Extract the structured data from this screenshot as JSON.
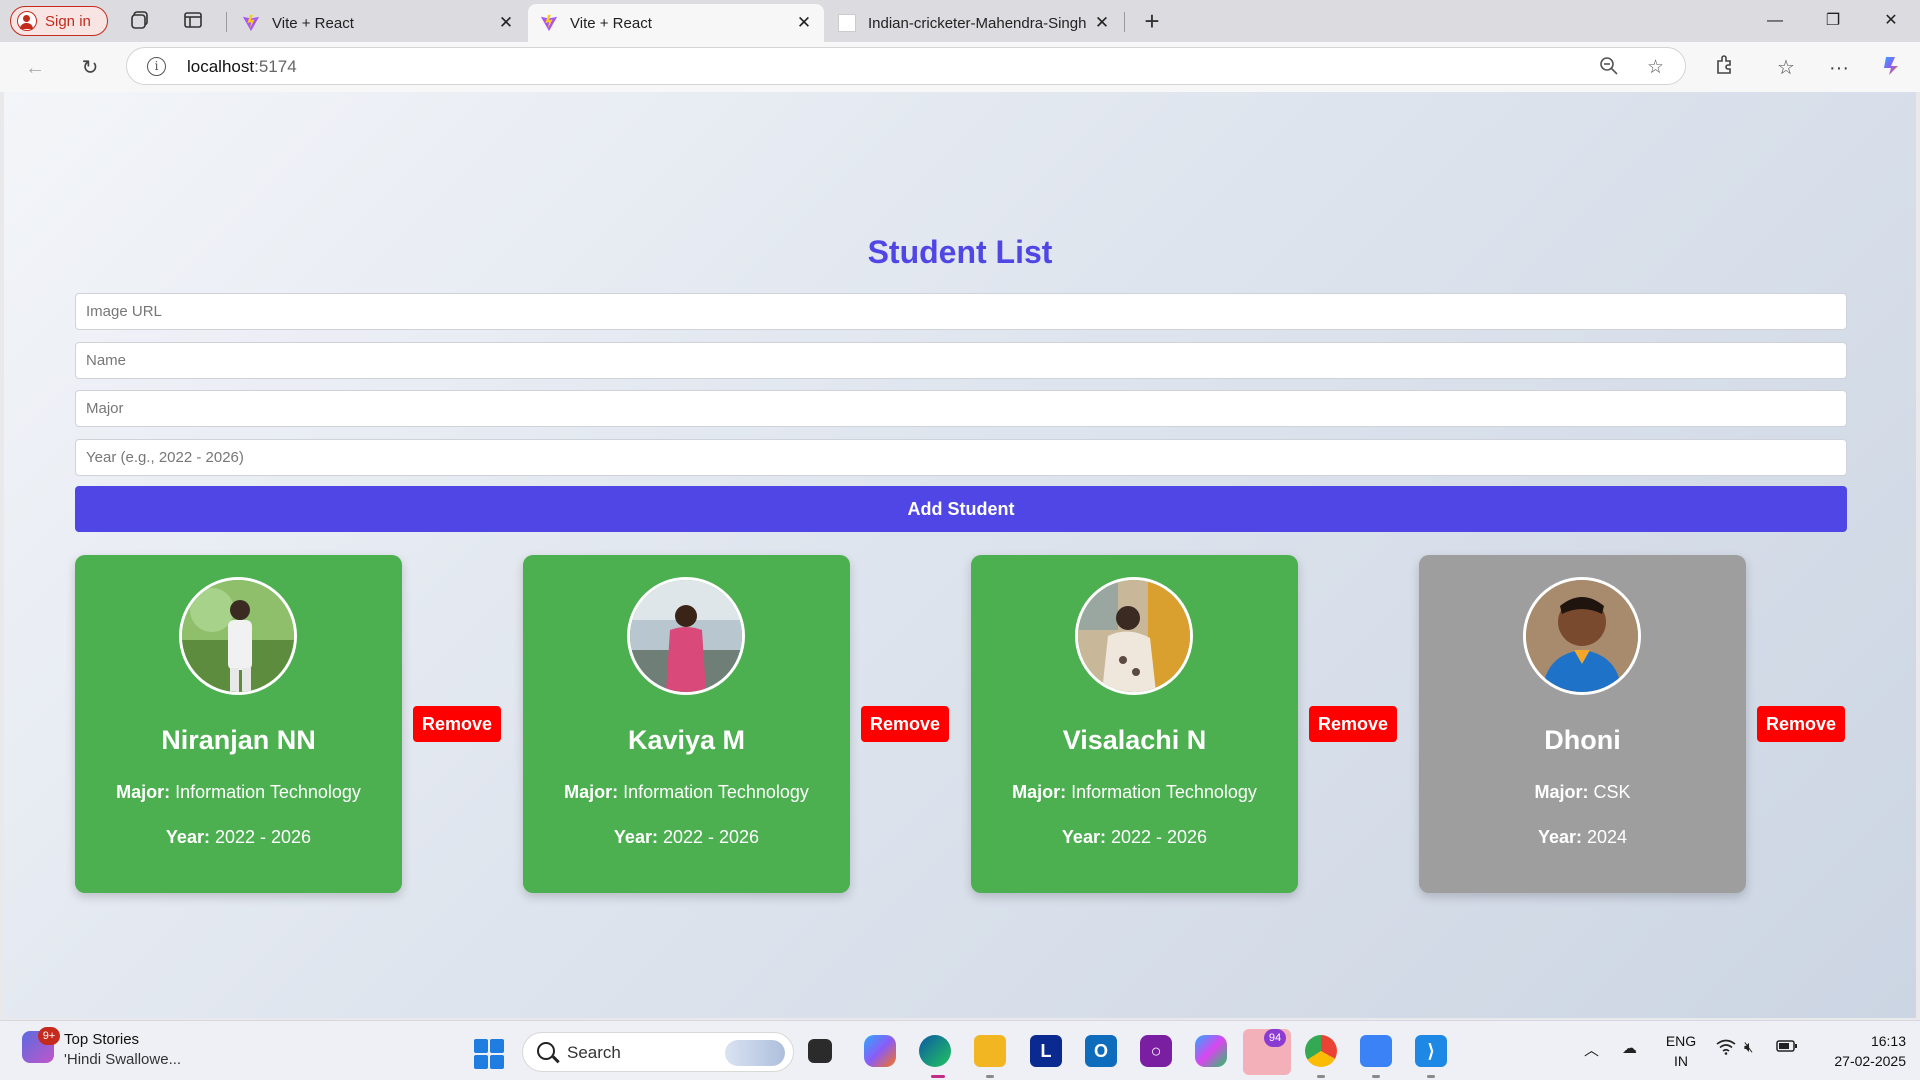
{
  "browser": {
    "signin_label": "Sign in",
    "tabs": [
      {
        "title": "Vite + React",
        "active": false
      },
      {
        "title": "Vite + React",
        "active": true
      },
      {
        "title": "Indian-cricketer-Mahendra-Singh",
        "active": false
      }
    ],
    "url_host": "localhost",
    "url_port": ":5174"
  },
  "app": {
    "title": "Student List",
    "inputs": {
      "image_url_placeholder": "Image URL",
      "name_placeholder": "Name",
      "major_placeholder": "Major",
      "year_placeholder": "Year (e.g., 2022 - 2026)"
    },
    "add_button": "Add Student",
    "major_label": "Major:",
    "year_label": "Year:",
    "remove_label": "Remove",
    "students": [
      {
        "name": "Niranjan NN",
        "major": "Information Technology",
        "year": "2022 - 2026",
        "color": "#4caf50"
      },
      {
        "name": "Kaviya M",
        "major": "Information Technology",
        "year": "2022 - 2026",
        "color": "#4caf50"
      },
      {
        "name": "Visalachi N",
        "major": "Information Technology",
        "year": "2022 - 2026",
        "color": "#4caf50"
      },
      {
        "name": "Dhoni",
        "major": "CSK",
        "year": "2024",
        "color": "#9e9e9e"
      }
    ]
  },
  "taskbar": {
    "news_badge": "9+",
    "news_title": "Top Stories",
    "news_subtitle": "'Hindi Swallowe...",
    "search_label": "Search",
    "mail_badge": "94",
    "lang_top": "ENG",
    "lang_bottom": "IN",
    "time": "16:13",
    "date": "27-02-2025"
  }
}
